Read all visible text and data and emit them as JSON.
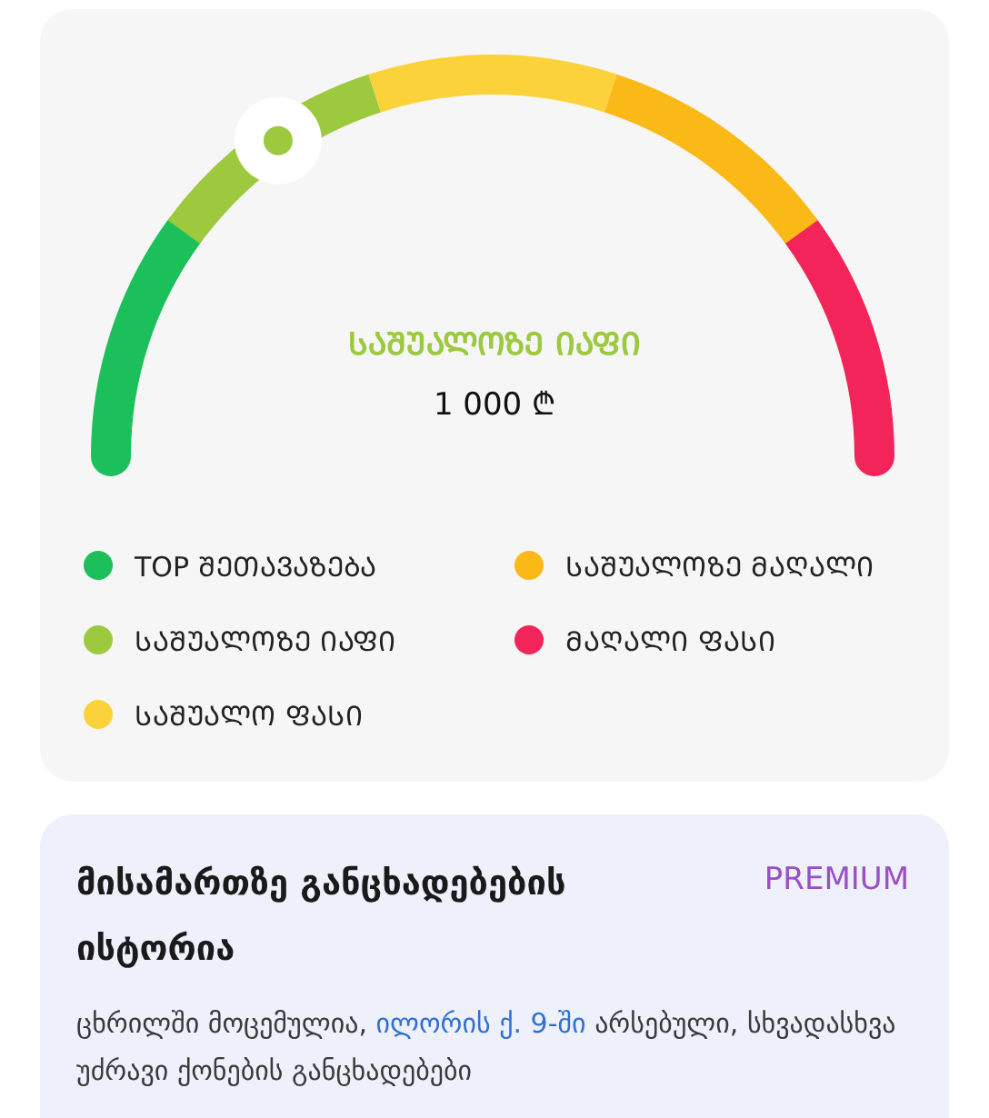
{
  "price_gauge": {
    "level": 0.31,
    "category": "ᲡᲐᲨᲣᲐᲚᲝᲖᲔ ᲘᲐᲤᲘ",
    "price": "1 000 ₾",
    "segments": [
      {
        "color": "#1cc05a"
      },
      {
        "color": "#9dc93f"
      },
      {
        "color": "#fcd23a"
      },
      {
        "color": "#fbb917"
      },
      {
        "color": "#f2245a"
      }
    ]
  },
  "legend": [
    {
      "label": "TOP ᲨᲔᲗᲐᲕᲐᲖᲔᲑᲐ",
      "color": "#1cc05a"
    },
    {
      "label": "ᲡᲐᲨᲣᲐᲚᲝᲖᲔ ᲛᲐᲦᲐᲚᲘ",
      "color": "#fbb917"
    },
    {
      "label": "ᲡᲐᲨᲣᲐᲚᲝᲖᲔ ᲘᲐᲤᲘ",
      "color": "#9dc93f"
    },
    {
      "label": "ᲛᲐᲦᲐᲚᲘ ᲤᲐᲡᲘ",
      "color": "#f2245a"
    },
    {
      "label": "ᲡᲐᲨᲣᲐᲚᲝ ᲤᲐᲡᲘ",
      "color": "#fcd23a"
    }
  ],
  "history_card": {
    "title": "მისამართზე განცხადებების ისტორია",
    "badge": "PREMIUM",
    "description": {
      "before": "ცხრილში მოცემულია, ",
      "link": "ილორის ქ. 9-ში",
      "after": " არსებული, სხვადასხვა უძრავი ქონების განცხადებები"
    }
  }
}
